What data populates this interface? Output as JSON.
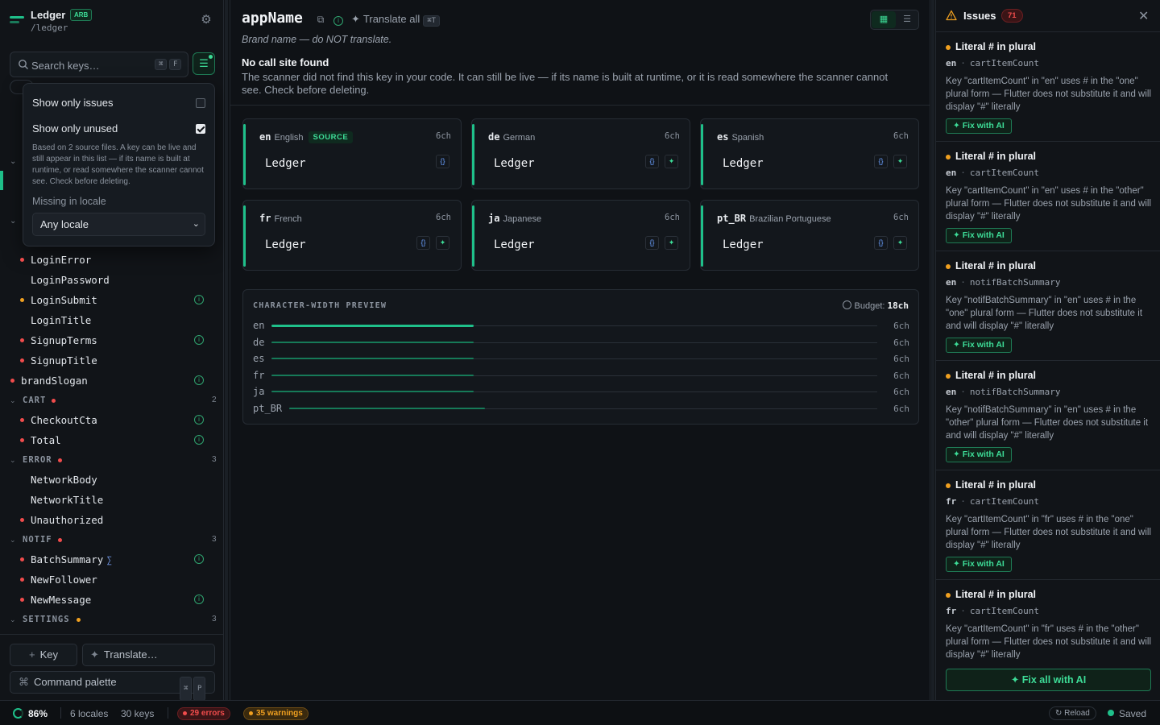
{
  "sidebar": {
    "app_name": "Ledger",
    "format_badge": "ARB",
    "path": "/ledger",
    "search_placeholder": "Search keys…",
    "search_kbd": [
      "⌘",
      "F"
    ],
    "filter_popover": {
      "show_only_issues": "Show only issues",
      "show_only_issues_checked": false,
      "show_only_unused": "Show only unused",
      "show_only_unused_checked": true,
      "help": "Based on 2 source files. A key can be live and still appear in this list — if its name is built at runtime, or read somewhere the scanner cannot see. Check before deleting.",
      "missing_label": "Missing in locale",
      "missing_value": "Any locale"
    },
    "tree": [
      {
        "kind": "key",
        "name": "LoginError",
        "dot": "red",
        "info": false,
        "indent": true
      },
      {
        "kind": "key",
        "name": "LoginPassword",
        "dot": null,
        "info": false,
        "indent": true
      },
      {
        "kind": "key",
        "name": "LoginSubmit",
        "dot": "amber",
        "info": true,
        "indent": true
      },
      {
        "kind": "key",
        "name": "LoginTitle",
        "dot": null,
        "info": false,
        "indent": true
      },
      {
        "kind": "key",
        "name": "SignupTerms",
        "dot": "red",
        "info": true,
        "indent": true
      },
      {
        "kind": "key",
        "name": "SignupTitle",
        "dot": "red",
        "info": false,
        "indent": true
      },
      {
        "kind": "key",
        "name": "brandSlogan",
        "dot": "red",
        "info": true,
        "indent": false
      },
      {
        "kind": "group",
        "name": "CART",
        "dot": "red",
        "count": "2"
      },
      {
        "kind": "key",
        "name": "CheckoutCta",
        "dot": "red",
        "info": true,
        "indent": true
      },
      {
        "kind": "key",
        "name": "Total",
        "dot": "red",
        "info": true,
        "indent": true
      },
      {
        "kind": "group",
        "name": "ERROR",
        "dot": "red",
        "count": "3"
      },
      {
        "kind": "key",
        "name": "NetworkBody",
        "dot": null,
        "info": false,
        "indent": true
      },
      {
        "kind": "key",
        "name": "NetworkTitle",
        "dot": null,
        "info": false,
        "indent": true
      },
      {
        "kind": "key",
        "name": "Unauthorized",
        "dot": "red",
        "info": false,
        "indent": true
      },
      {
        "kind": "group",
        "name": "NOTIF",
        "dot": "red",
        "count": "3"
      },
      {
        "kind": "key",
        "name": "BatchSummary",
        "dot": "red",
        "info": true,
        "indent": true,
        "plural": true
      },
      {
        "kind": "key",
        "name": "NewFollower",
        "dot": "red",
        "info": false,
        "indent": true
      },
      {
        "kind": "key",
        "name": "NewMessage",
        "dot": "red",
        "info": true,
        "indent": true
      },
      {
        "kind": "group",
        "name": "SETTINGS",
        "dot": "amber",
        "count": "3"
      }
    ],
    "add_key": "Key",
    "translate": "Translate…",
    "command_palette": "Command palette",
    "command_kbd": [
      "⌘",
      "P"
    ]
  },
  "main": {
    "key_name": "appName",
    "translate_all": "Translate all",
    "translate_all_kbd": "⌘T",
    "description": "Brand name — do NOT translate.",
    "no_call_title": "No call site found",
    "no_call_body": "The scanner did not find this key in your code. It can still be live — if its name is built at runtime, or it is read somewhere the scanner cannot see. Check before deleting.",
    "locales": [
      {
        "code": "en",
        "name": "English",
        "source": "SOURCE",
        "width": "6ch",
        "value": "Ledger"
      },
      {
        "code": "de",
        "name": "German",
        "width": "6ch",
        "value": "Ledger"
      },
      {
        "code": "es",
        "name": "Spanish",
        "width": "6ch",
        "value": "Ledger"
      },
      {
        "code": "fr",
        "name": "French",
        "width": "6ch",
        "value": "Ledger"
      },
      {
        "code": "ja",
        "name": "Japanese",
        "width": "6ch",
        "value": "Ledger"
      },
      {
        "code": "pt_BR",
        "name": "Brazilian Portuguese",
        "width": "6ch",
        "value": "Ledger"
      }
    ],
    "preview": {
      "title": "CHARACTER-WIDTH PREVIEW",
      "budget_label": "Budget:",
      "budget_value": "18ch",
      "rows": [
        {
          "code": "en",
          "width": "6ch",
          "chars": 6
        },
        {
          "code": "de",
          "width": "6ch",
          "chars": 6
        },
        {
          "code": "es",
          "width": "6ch",
          "chars": 6
        },
        {
          "code": "fr",
          "width": "6ch",
          "chars": 6
        },
        {
          "code": "ja",
          "width": "6ch",
          "chars": 6
        },
        {
          "code": "pt_BR",
          "width": "6ch",
          "chars": 6
        }
      ],
      "budget_chars": 18
    }
  },
  "issues": {
    "title": "Issues",
    "count": "71",
    "items": [
      {
        "title": "Literal # in plural",
        "locale": "en",
        "key": "cartItemCount",
        "text": "Key \"cartItemCount\" in \"en\" uses # in the \"one\" plural form — Flutter does not substitute it and will display \"#\" literally",
        "fix": "Fix with AI"
      },
      {
        "title": "Literal # in plural",
        "locale": "en",
        "key": "cartItemCount",
        "text": "Key \"cartItemCount\" in \"en\" uses # in the \"other\" plural form — Flutter does not substitute it and will display \"#\" literally",
        "fix": "Fix with AI"
      },
      {
        "title": "Literal # in plural",
        "locale": "en",
        "key": "notifBatchSummary",
        "text": "Key \"notifBatchSummary\" in \"en\" uses # in the \"one\" plural form — Flutter does not substitute it and will display \"#\" literally",
        "fix": "Fix with AI"
      },
      {
        "title": "Literal # in plural",
        "locale": "en",
        "key": "notifBatchSummary",
        "text": "Key \"notifBatchSummary\" in \"en\" uses # in the \"other\" plural form — Flutter does not substitute it and will display \"#\" literally",
        "fix": "Fix with AI"
      },
      {
        "title": "Literal # in plural",
        "locale": "fr",
        "key": "cartItemCount",
        "text": "Key \"cartItemCount\" in \"fr\" uses # in the \"one\" plural form — Flutter does not substitute it and will display \"#\" literally",
        "fix": "Fix with AI"
      },
      {
        "title": "Literal # in plural",
        "locale": "fr",
        "key": "cartItemCount",
        "text": "Key \"cartItemCount\" in \"fr\" uses # in the \"other\" plural form — Flutter does not substitute it and will display \"#\" literally",
        "fix": ""
      }
    ],
    "fix_all": "Fix all with AI"
  },
  "status": {
    "coverage": "86%",
    "coverage_fraction": 0.86,
    "locales": "6 locales",
    "keys": "30 keys",
    "errors": "29 errors",
    "warnings": "35 warnings",
    "reload": "Reload",
    "saved": "Saved"
  },
  "colors": {
    "accent": "#1fc08a",
    "error": "#f14c4c",
    "warning": "#f0a020"
  }
}
